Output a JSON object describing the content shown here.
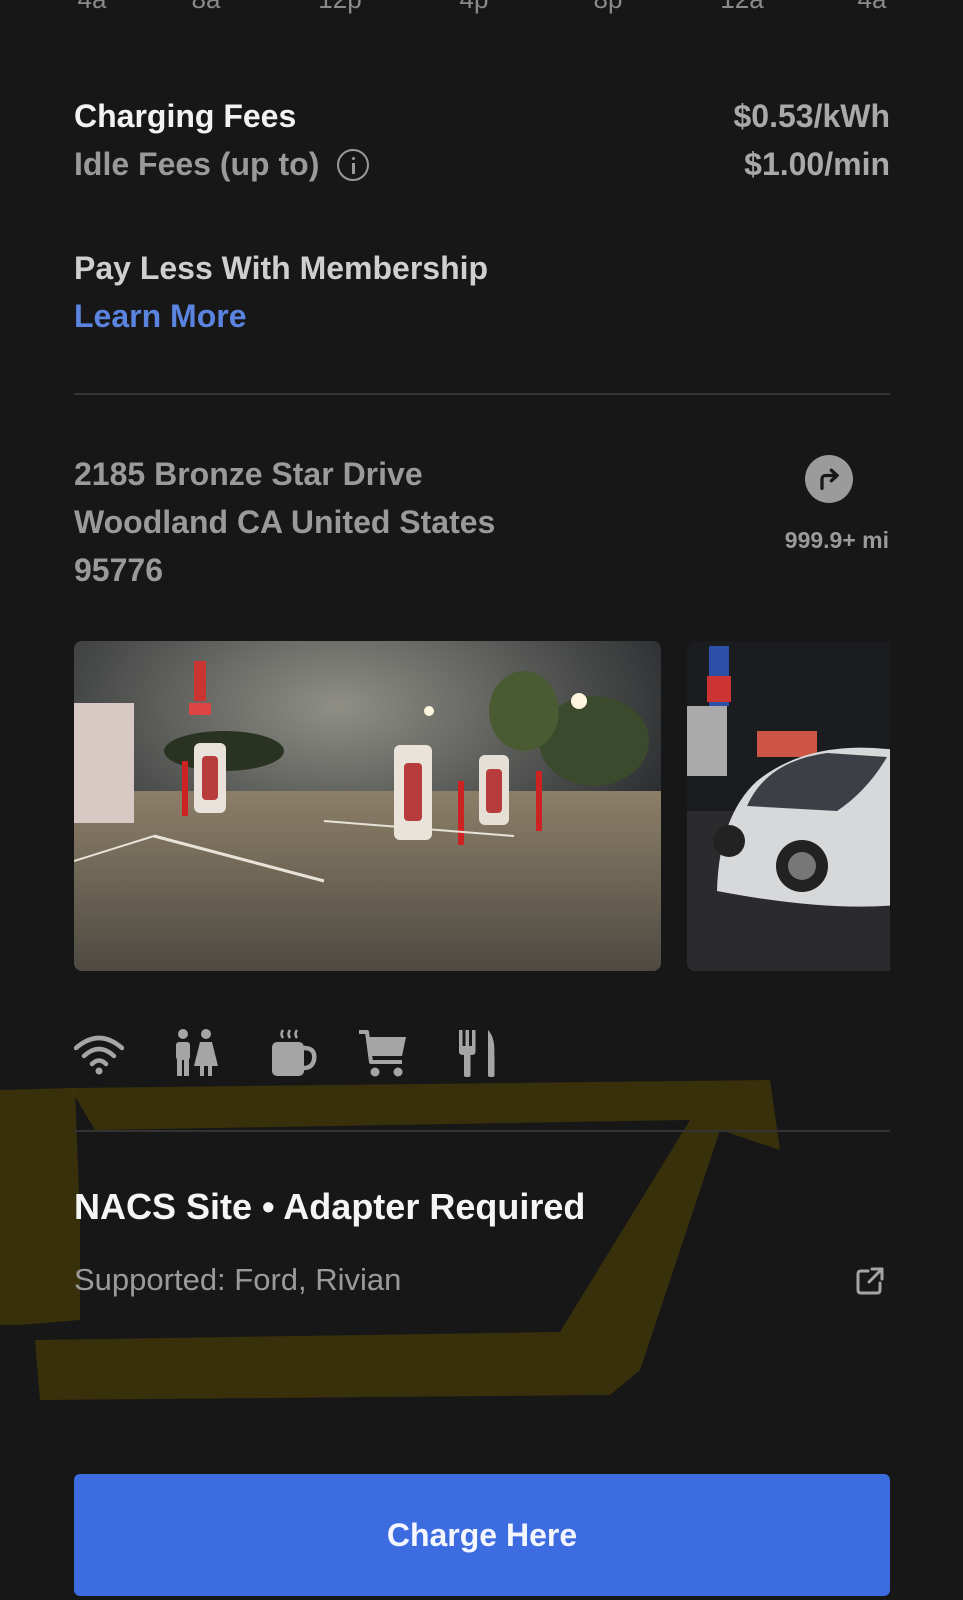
{
  "hour_axis": [
    "4a",
    "8a",
    "12p",
    "4p",
    "8p",
    "12a",
    "4a"
  ],
  "fees": {
    "charging_label": "Charging Fees",
    "charging_value": "$0.53/kWh",
    "idle_label": "Idle Fees (up to)",
    "idle_value": "$1.00/min"
  },
  "membership": {
    "label": "Pay Less With Membership",
    "link": "Learn More"
  },
  "address": {
    "line1": "2185 Bronze Star Drive",
    "line2": "Woodland CA United States",
    "line3": "95776",
    "distance": "999.9+ mi"
  },
  "amenities": [
    "wifi-icon",
    "restroom-icon",
    "coffee-icon",
    "shopping-cart-icon",
    "restaurant-icon"
  ],
  "site": {
    "title": "NACS Site • Adapter Required",
    "supported": "Supported: Ford, Rivian"
  },
  "action": {
    "charge_label": "Charge Here"
  },
  "colors": {
    "background": "#171717",
    "link": "#5b84e0",
    "button": "#3d6be0",
    "highlight": "#6b5a00"
  }
}
